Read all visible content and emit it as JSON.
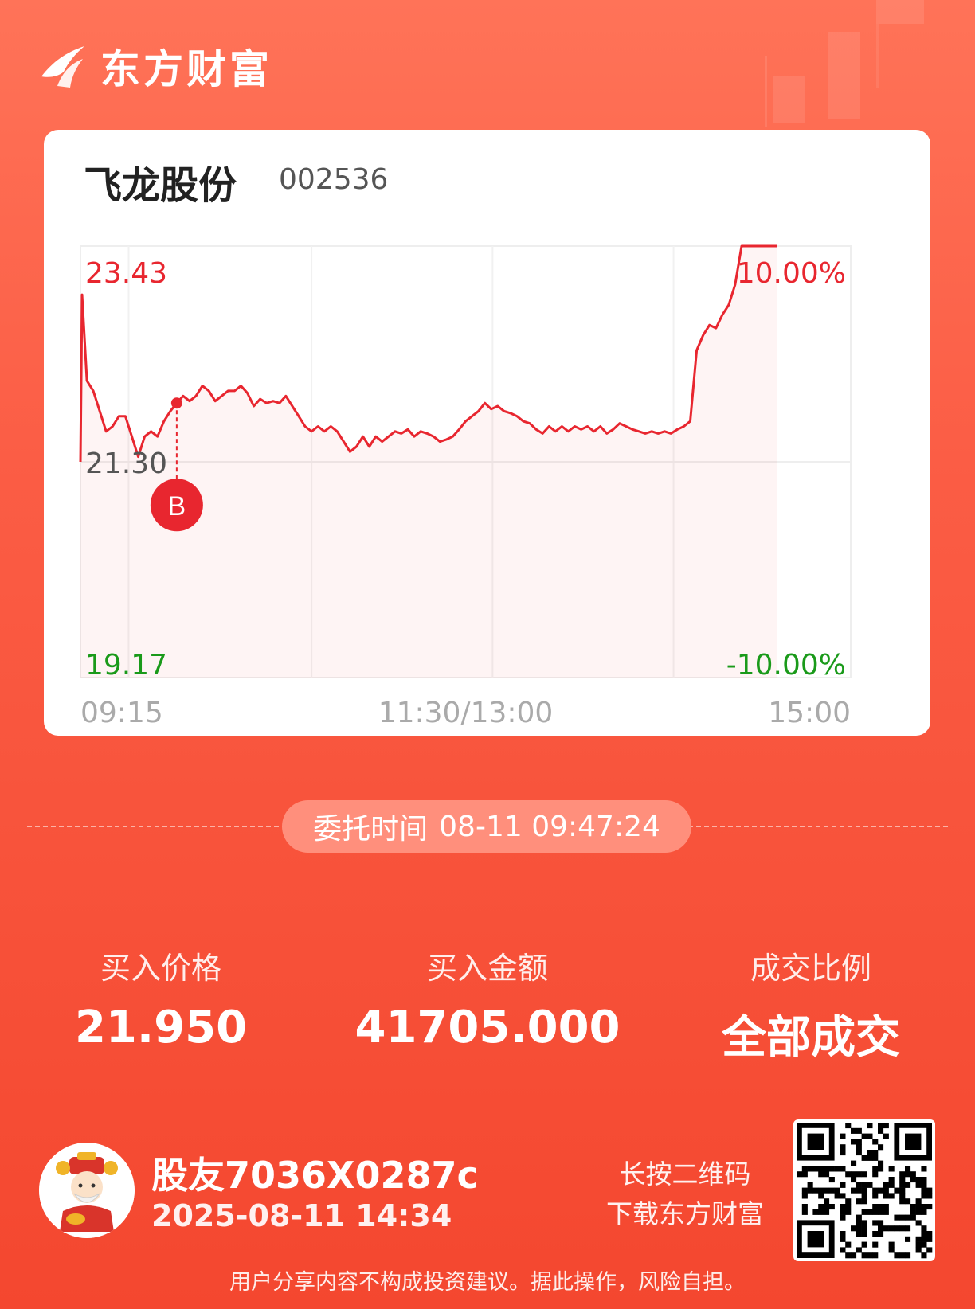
{
  "brand": {
    "name": "东方财富"
  },
  "stock": {
    "name": "飞龙股份",
    "code": "002536"
  },
  "chart_data": {
    "type": "line",
    "title": "",
    "y_labels": {
      "high": "23.43",
      "base": "21.30",
      "low": "19.17"
    },
    "pct_labels": {
      "high": "10.00%",
      "low": "-10.00%"
    },
    "x_labels": [
      "09:15",
      "11:30/13:00",
      "15:00"
    ],
    "ylim": [
      19.17,
      23.43
    ],
    "session_minutes": 240,
    "base_price": 21.3,
    "series": [
      {
        "values": [
          [
            0,
            21.3
          ],
          [
            0.5,
            22.95
          ],
          [
            2,
            22.1
          ],
          [
            4,
            22.0
          ],
          [
            6,
            21.8
          ],
          [
            8,
            21.6
          ],
          [
            10,
            21.65
          ],
          [
            12,
            21.75
          ],
          [
            14,
            21.75
          ],
          [
            16,
            21.55
          ],
          [
            18,
            21.35
          ],
          [
            20,
            21.55
          ],
          [
            22,
            21.6
          ],
          [
            24,
            21.55
          ],
          [
            26,
            21.7
          ],
          [
            28,
            21.8
          ],
          [
            30,
            21.88
          ],
          [
            32,
            21.95
          ],
          [
            34,
            21.9
          ],
          [
            36,
            21.95
          ],
          [
            38,
            22.05
          ],
          [
            40,
            22.0
          ],
          [
            42,
            21.9
          ],
          [
            44,
            21.95
          ],
          [
            46,
            22.0
          ],
          [
            48,
            22.0
          ],
          [
            50,
            22.05
          ],
          [
            52,
            21.98
          ],
          [
            54,
            21.85
          ],
          [
            56,
            21.92
          ],
          [
            58,
            21.88
          ],
          [
            60,
            21.9
          ],
          [
            62,
            21.88
          ],
          [
            64,
            21.95
          ],
          [
            66,
            21.85
          ],
          [
            68,
            21.75
          ],
          [
            70,
            21.65
          ],
          [
            72,
            21.6
          ],
          [
            74,
            21.65
          ],
          [
            76,
            21.6
          ],
          [
            78,
            21.65
          ],
          [
            80,
            21.6
          ],
          [
            82,
            21.5
          ],
          [
            84,
            21.4
          ],
          [
            86,
            21.45
          ],
          [
            88,
            21.55
          ],
          [
            90,
            21.45
          ],
          [
            92,
            21.55
          ],
          [
            94,
            21.5
          ],
          [
            96,
            21.55
          ],
          [
            98,
            21.6
          ],
          [
            100,
            21.58
          ],
          [
            102,
            21.62
          ],
          [
            104,
            21.55
          ],
          [
            106,
            21.6
          ],
          [
            108,
            21.58
          ],
          [
            110,
            21.55
          ],
          [
            112,
            21.5
          ],
          [
            114,
            21.52
          ],
          [
            116,
            21.55
          ],
          [
            118,
            21.62
          ],
          [
            120,
            21.7
          ],
          [
            122,
            21.75
          ],
          [
            124,
            21.8
          ],
          [
            126,
            21.88
          ],
          [
            128,
            21.82
          ],
          [
            130,
            21.85
          ],
          [
            132,
            21.8
          ],
          [
            134,
            21.78
          ],
          [
            136,
            21.75
          ],
          [
            138,
            21.7
          ],
          [
            140,
            21.68
          ],
          [
            142,
            21.62
          ],
          [
            144,
            21.58
          ],
          [
            146,
            21.65
          ],
          [
            148,
            21.6
          ],
          [
            150,
            21.65
          ],
          [
            152,
            21.6
          ],
          [
            154,
            21.65
          ],
          [
            156,
            21.62
          ],
          [
            158,
            21.65
          ],
          [
            160,
            21.6
          ],
          [
            162,
            21.65
          ],
          [
            164,
            21.58
          ],
          [
            166,
            21.62
          ],
          [
            168,
            21.68
          ],
          [
            170,
            21.65
          ],
          [
            172,
            21.62
          ],
          [
            174,
            21.6
          ],
          [
            176,
            21.58
          ],
          [
            178,
            21.6
          ],
          [
            180,
            21.58
          ],
          [
            182,
            21.6
          ],
          [
            184,
            21.58
          ],
          [
            186,
            21.62
          ],
          [
            188,
            21.65
          ],
          [
            190,
            21.7
          ],
          [
            192,
            22.4
          ],
          [
            194,
            22.55
          ],
          [
            196,
            22.65
          ],
          [
            198,
            22.62
          ],
          [
            200,
            22.75
          ],
          [
            202,
            22.85
          ],
          [
            204,
            23.05
          ],
          [
            206,
            23.43
          ],
          [
            208,
            23.43
          ],
          [
            210,
            23.43
          ],
          [
            212,
            23.43
          ],
          [
            214,
            23.43
          ],
          [
            217,
            23.43
          ]
        ]
      }
    ],
    "marker": {
      "label": "B",
      "minute": 30,
      "price": 21.88
    }
  },
  "order": {
    "time_label": "委托时间",
    "time_value": "08-11 09:47:24"
  },
  "stats": [
    {
      "label": "买入价格",
      "value": "21.950"
    },
    {
      "label": "买入金额",
      "value": "41705.000"
    },
    {
      "label": "成交比例",
      "value": "全部成交"
    }
  ],
  "user": {
    "name": "股友7036X0287c",
    "datetime": "2025-08-11 14:34"
  },
  "qr": {
    "hint_line1": "长按二维码",
    "hint_line2": "下载东方财富"
  },
  "disclaimer": "用户分享内容不构成投资建议。据此操作，风险自担。",
  "colors": {
    "up": "#e8262f",
    "down": "#1a9a1a",
    "base": "#555555",
    "axis": "#aaaaaa"
  }
}
